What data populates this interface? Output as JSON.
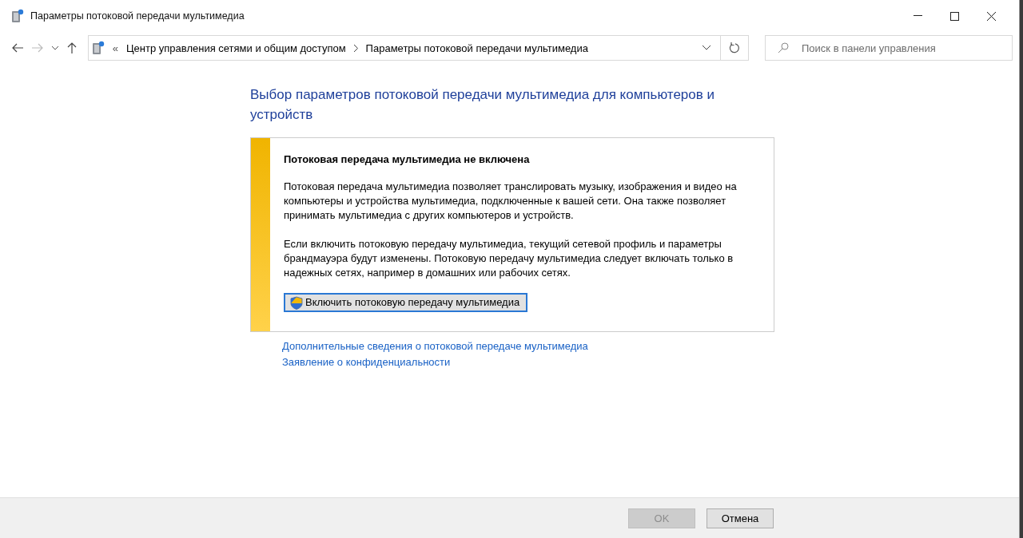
{
  "window": {
    "title": "Параметры потоковой передачи мультимедиа"
  },
  "address_bar": {
    "overflow": "«",
    "breadcrumbs": [
      {
        "label": "Центр управления сетями и общим доступом"
      },
      {
        "label": "Параметры потоковой передачи мультимедиа"
      }
    ]
  },
  "search": {
    "placeholder": "Поиск в панели управления"
  },
  "heading": "Выбор параметров потоковой передачи мультимедиа для компьютеров и устройств",
  "notice": {
    "title": "Потоковая передача мультимедиа не включена",
    "paragraphs": [
      "Потоковая передача мультимедиа позволяет транслировать музыку, изображения и видео на компьютеры и устройства мультимедиа, подключенные к вашей сети. Она также позволяет принимать мультимедиа с других компьютеров и устройств.",
      "Если включить потоковую передачу мультимедиа, текущий сетевой профиль и параметры брандмауэра будут изменены. Потоковую передачу мультимедиа следует включать только в надежных сетях, например в домашних или рабочих сетях."
    ],
    "button": "Включить потоковую передачу мультимедиа"
  },
  "links": [
    "Дополнительные сведения о потоковой передаче мультимедиа",
    "Заявление о конфиденциальности"
  ],
  "buttons": [
    {
      "label": "OK",
      "disabled": true
    },
    {
      "label": "Отмена",
      "disabled": false
    }
  ]
}
